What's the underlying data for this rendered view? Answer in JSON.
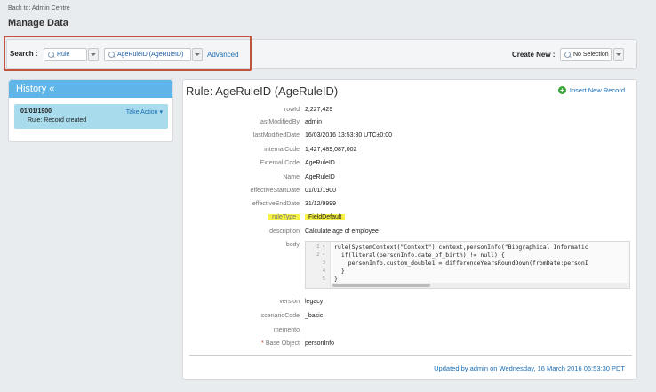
{
  "breadcrumb": {
    "back_label": "Back to: Admin Centre"
  },
  "page": {
    "title": "Manage Data"
  },
  "search": {
    "label": "Search :",
    "type_value": "Rule",
    "record_value": "AgeRuleID (AgeRuleID)",
    "advanced_label": "Advanced"
  },
  "create": {
    "label": "Create New :",
    "value": "No Selection"
  },
  "history": {
    "title": "History «",
    "entries": [
      {
        "date": "01/01/1900",
        "action_label": "Take Action ▾",
        "text": "Rule: Record created"
      }
    ]
  },
  "record": {
    "title": "Rule: AgeRuleID (AgeRuleID)",
    "insert_label": "Insert New Record",
    "fields": [
      {
        "label": "rowId",
        "value": "2,227,429"
      },
      {
        "label": "lastModifiedBy",
        "value": "admin"
      },
      {
        "label": "lastModifiedDate",
        "value": "16/03/2016 13:53:30 UTC±0:00"
      },
      {
        "label": "internalCode",
        "value": "1,427,489,087,002"
      },
      {
        "label": "External Code",
        "value": "AgeRuleID"
      },
      {
        "label": "Name",
        "value": "AgeRuleID"
      },
      {
        "label": "effectiveStartDate",
        "value": "01/01/1900"
      },
      {
        "label": "effectiveEndDate",
        "value": "31/12/9999"
      },
      {
        "label": "ruleType",
        "value": "FieldDefault"
      },
      {
        "label": "description",
        "value": "Calculate age of employee"
      },
      {
        "label": "body",
        "value": ""
      },
      {
        "label": "version",
        "value": "legacy"
      },
      {
        "label": "scenarioCode",
        "value": "_basic"
      },
      {
        "label": "memento",
        "value": ""
      },
      {
        "label": "Base Object",
        "value": "personInfo",
        "required_mark": "*"
      }
    ],
    "body_lines": [
      {
        "num": "1 ▾",
        "text": "rule(SystemContext(\"Context\") context,personInfo(\"Biographical Informatic"
      },
      {
        "num": "2 ▾",
        "text": "  if(literal(personInfo.date_of_birth) != null) {"
      },
      {
        "num": "3",
        "text": "    personInfo.custom_double1 = differenceYearsRoundDown(fromDate:personI"
      },
      {
        "num": "4",
        "text": "  }"
      },
      {
        "num": "5",
        "text": "}"
      }
    ],
    "updated_text": "Updated by admin on Wednesday, 16 March 2016 06:53:30 PDT"
  },
  "colors": {
    "accent": "#5fb4e8",
    "link": "#1a6db5",
    "highlight": "#f6f142",
    "search_outline": "#c0533a"
  }
}
